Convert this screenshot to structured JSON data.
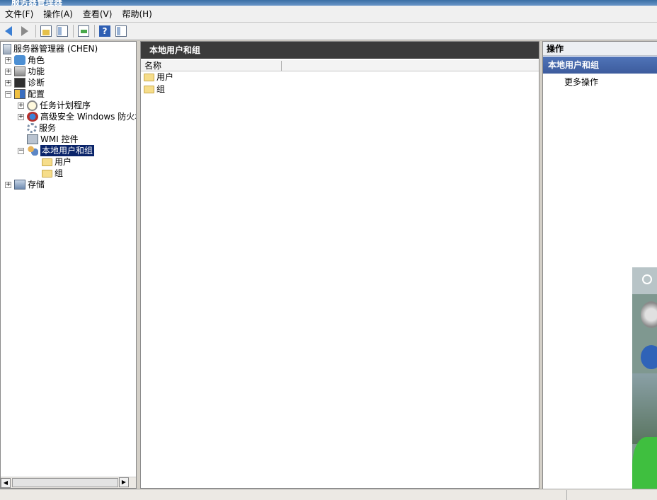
{
  "window": {
    "title": "服务器管理器"
  },
  "menu": {
    "file": "文件(F)",
    "action": "操作(A)",
    "view": "查看(V)",
    "help": "帮助(H)"
  },
  "toolbar": {
    "back_icon": "back-arrow-icon",
    "forward_icon": "forward-arrow-icon",
    "up_icon": "up-folder-icon",
    "show_pane_icon": "show-hide-pane-icon",
    "export_icon": "export-list-icon",
    "help_icon": "help-icon",
    "action_pane_icon": "action-pane-icon"
  },
  "tree": {
    "root": "服务器管理器 (CHEN)",
    "roles": "角色",
    "features": "功能",
    "diagnostics": "诊断",
    "configuration": "配置",
    "task_scheduler": "任务计划程序",
    "firewall": "高级安全 Windows 防火墙",
    "services": "服务",
    "wmi": "WMI 控件",
    "local_users_groups": "本地用户和组",
    "users": "用户",
    "groups": "组",
    "storage": "存储"
  },
  "center": {
    "header": "本地用户和组",
    "column_name": "名称",
    "items": [
      "用户",
      "组"
    ]
  },
  "actions": {
    "header": "操作",
    "section": "本地用户和组",
    "more": "更多操作"
  },
  "colors": {
    "selection": "#0a246a",
    "section_header": "#4f73b8",
    "pane_header": "#3b3b3b"
  }
}
